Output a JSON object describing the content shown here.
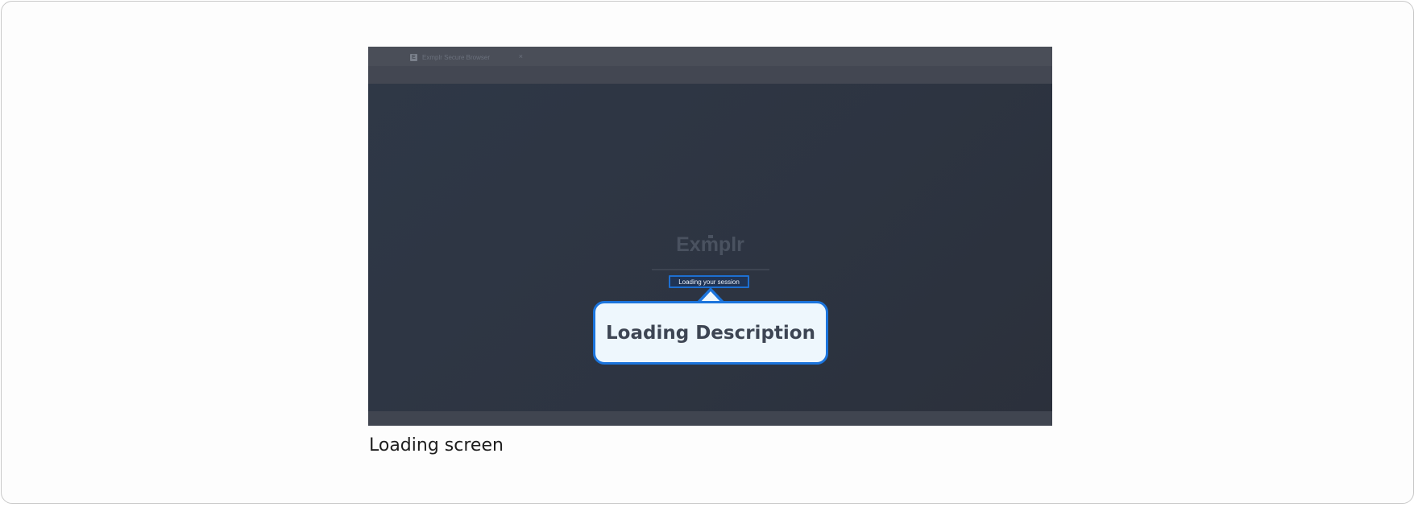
{
  "browser": {
    "tab_title": "Exmplr Secure Browser",
    "tab_favicon_letter": "E",
    "tab_close_glyph": "×"
  },
  "app": {
    "logo_text": "Exmplr",
    "loading_message": "Loading your session"
  },
  "callout": {
    "label": "Loading Description"
  },
  "figure": {
    "caption": "Loading screen"
  },
  "colors": {
    "accent": "#1b74dc",
    "callout_bg": "#eef7fd",
    "screen_bg": "#2f3847"
  },
  "icons": {
    "tab_favicon": "exmplr-favicon-icon",
    "tab_close": "close-icon"
  }
}
